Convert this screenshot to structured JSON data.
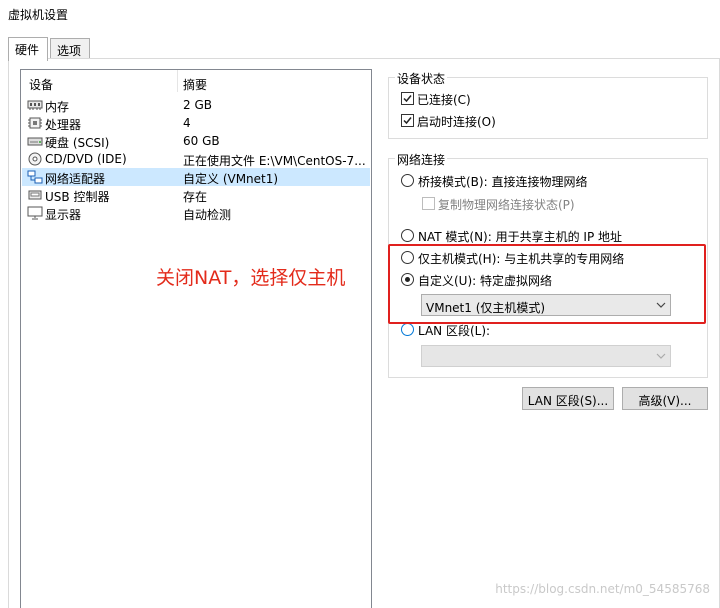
{
  "window": {
    "title": "虚拟机设置"
  },
  "tabs": [
    {
      "label": "硬件",
      "active": true
    },
    {
      "label": "选项",
      "active": false
    }
  ],
  "device_list": {
    "columns": [
      "设备",
      "摘要"
    ],
    "rows": [
      {
        "icon": "memory-icon",
        "name": "内存",
        "summary": "2 GB"
      },
      {
        "icon": "processor-icon",
        "name": "处理器",
        "summary": "4"
      },
      {
        "icon": "hard-disk-icon",
        "name": "硬盘 (SCSI)",
        "summary": "60 GB"
      },
      {
        "icon": "cd-dvd-icon",
        "name": "CD/DVD (IDE)",
        "summary": "正在使用文件 E:\\VM\\CentOS-7..."
      },
      {
        "icon": "network-adapter-icon",
        "name": "网络适配器",
        "summary": "自定义 (VMnet1)",
        "selected": true
      },
      {
        "icon": "usb-icon",
        "name": "USB 控制器",
        "summary": "存在"
      },
      {
        "icon": "display-icon",
        "name": "显示器",
        "summary": "自动检测"
      }
    ]
  },
  "device_status": {
    "title": "设备状态",
    "connected": {
      "label": "已连接(C)",
      "checked": true
    },
    "connect_at_power_on": {
      "label": "启动时连接(O)",
      "checked": true
    }
  },
  "network_connection": {
    "title": "网络连接",
    "bridged": {
      "label": "桥接模式(B): 直接连接物理网络",
      "selected": false
    },
    "replicate": {
      "label": "复制物理网络连接状态(P)",
      "checked": false
    },
    "nat": {
      "label": "NAT 模式(N): 用于共享主机的 IP 地址",
      "selected": false
    },
    "host_only": {
      "label": "仅主机模式(H): 与主机共享的专用网络",
      "selected": false
    },
    "custom": {
      "label": "自定义(U): 特定虚拟网络",
      "selected": true
    },
    "custom_select_value": "VMnet1 (仅主机模式)",
    "lan_segment": {
      "label": "LAN 区段(L):",
      "selected": false
    },
    "lan_segment_select_value": ""
  },
  "buttons": {
    "lan_segments": "LAN 区段(S)...",
    "advanced": "高级(V)..."
  },
  "annotation": {
    "text": "关闭NAT，选择仅主机",
    "color": "#e32b1b"
  },
  "watermark": "https://blog.csdn.net/m0_54585768"
}
